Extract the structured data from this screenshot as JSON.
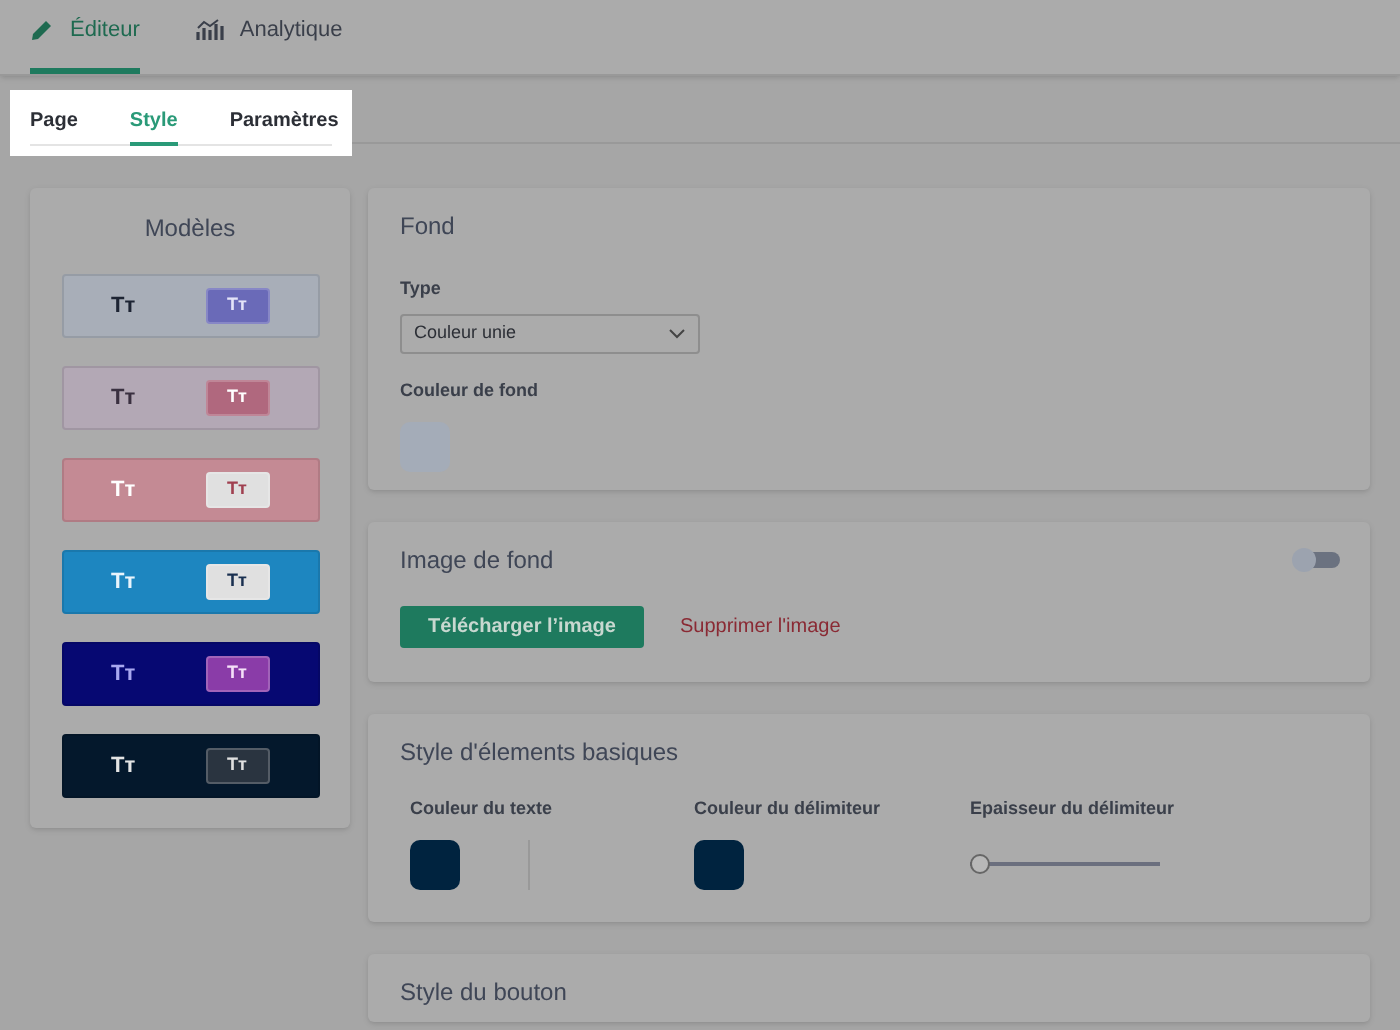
{
  "main_tabs": [
    {
      "label": "Éditeur",
      "selected": true
    },
    {
      "label": "Analytique",
      "selected": false
    }
  ],
  "sub_tabs": [
    {
      "label": "Page",
      "selected": false
    },
    {
      "label": "Style",
      "selected": true
    },
    {
      "label": "Paramètres",
      "selected": false
    }
  ],
  "templates": {
    "title": "Modèles",
    "items": [
      {
        "kind": "slate",
        "label": "Tт",
        "button_label": "Tт",
        "color": "#a8aeb8"
      },
      {
        "kind": "lilac",
        "label": "Tт",
        "button_label": "Tт",
        "color": "#b3a8b5"
      },
      {
        "kind": "rose",
        "label": "Tт",
        "button_label": "Tт",
        "color": "#c48a94"
      },
      {
        "kind": "sky",
        "label": "Tт",
        "button_label": "Tт",
        "color": "#1d86c0"
      },
      {
        "kind": "indigo",
        "label": "Tт",
        "button_label": "Tт",
        "color": "#060872"
      },
      {
        "kind": "night",
        "label": "Tт",
        "button_label": "Tт",
        "color": "#04182c"
      }
    ]
  },
  "fond": {
    "title": "Fond",
    "type_label": "Type",
    "type_value": "Couleur unie",
    "color_label": "Couleur de fond",
    "color": "#a4acb8"
  },
  "image_de_fond": {
    "title": "Image de fond",
    "enabled": false,
    "upload_button": "Télécharger l’image",
    "delete_link": "Supprimer l'image"
  },
  "basic_style": {
    "title": "Style d'élements basiques",
    "text_color_label": "Couleur du texte",
    "text_swatch": {
      "color": "#00233f"
    },
    "divider_color_label": "Couleur du délimiteur",
    "divider_swatch": {
      "color": "#00233f"
    },
    "thickness_label": "Epaisseur du délimiteur",
    "thickness": {
      "level": 0
    }
  },
  "button_style": {
    "title": "Style du bouton"
  }
}
